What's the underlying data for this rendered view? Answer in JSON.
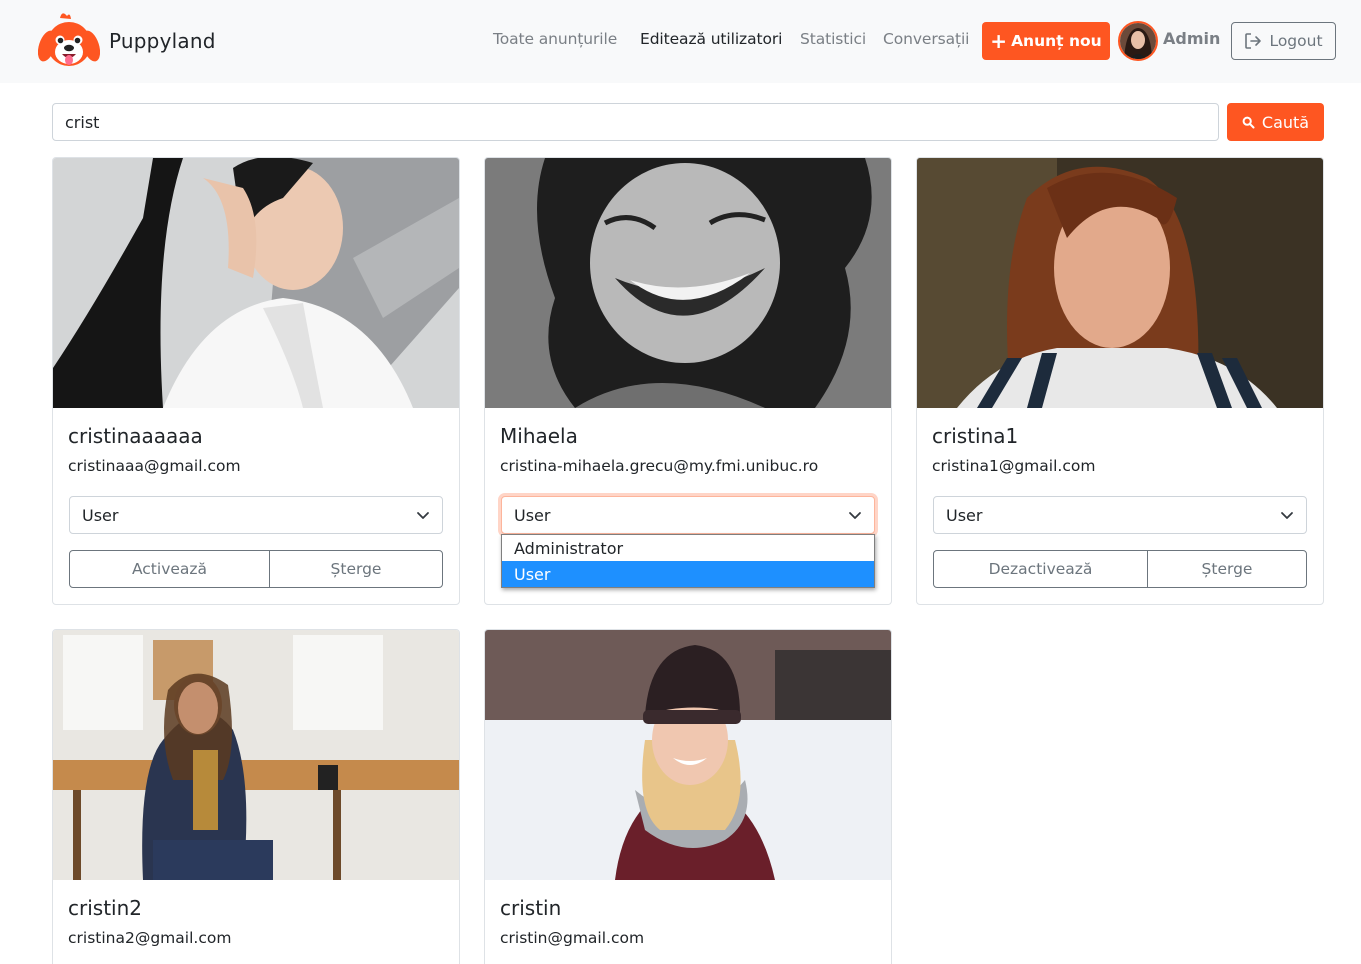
{
  "brand": {
    "name": "Puppyland",
    "logo_icon": "dog-face-icon"
  },
  "nav": {
    "links": [
      "Toate anunțurile",
      "Editează utilizatori",
      "Statistici",
      "Conversații"
    ],
    "active": "Editează utilizatori",
    "new_ad_label": "Anunț nou",
    "user_label": "Admin",
    "logout_label": "Logout"
  },
  "search": {
    "value": "crist",
    "button_label": "Caută"
  },
  "users": [
    {
      "username": "cristinaaaaaa",
      "email": "cristinaaa@gmail.com",
      "role": "User",
      "toggle_label": "Activează",
      "delete_label": "Șterge"
    },
    {
      "username": "Mihaela",
      "email": "cristina-mihaela.grecu@my.fmi.unibuc.ro",
      "role": "User",
      "toggle_label": "",
      "delete_label": ""
    },
    {
      "username": "cristina1",
      "email": "cristina1@gmail.com",
      "role": "User",
      "toggle_label": "Dezactivează",
      "delete_label": "Șterge"
    },
    {
      "username": "cristin2",
      "email": "cristina2@gmail.com"
    },
    {
      "username": "cristin",
      "email": "cristin@gmail.com"
    }
  ],
  "role_dropdown": {
    "options": [
      "Administrator",
      "User"
    ],
    "selected": "User"
  },
  "colors": {
    "accent": "#fe5621",
    "navbar_bg": "#f8f9fa",
    "dropdown_highlight": "#1e90ff",
    "muted": "#6c757d"
  }
}
